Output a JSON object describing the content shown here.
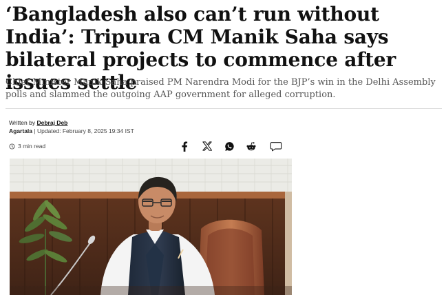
{
  "article": {
    "headline": "‘Bangladesh also can’t run without India’: Tripura CM Manik Saha says bilateral projects to commence after issues settle",
    "summary": "Chief Minister Manik Saha praised PM Narendra Modi for the BJP’s win in the Delhi Assembly polls and slammed the outgoing AAP government for alleged corruption.",
    "written_by_label": "Written by",
    "author": "Debraj Deb",
    "location": "Agartala",
    "separator": "|",
    "updated_text": "Updated: February 8, 2025 19:34 IST",
    "read_time": "3 min read"
  },
  "share_icons": [
    "facebook-icon",
    "x-icon",
    "whatsapp-icon",
    "reddit-icon",
    "comment-icon"
  ],
  "colors": {
    "headline": "#111111",
    "summary": "#555555",
    "divider": "#dcdcdc",
    "photo_background": "#5b3320"
  }
}
